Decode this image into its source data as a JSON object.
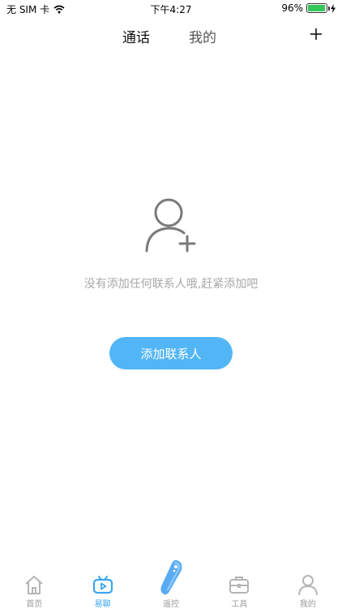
{
  "status_bar": {
    "carrier": "无 SIM 卡",
    "time": "下午4:27",
    "battery_percent": "96%",
    "battery_level": 0.96
  },
  "header": {
    "tabs": [
      {
        "label": "通话",
        "active": true
      },
      {
        "label": "我的",
        "active": false
      }
    ],
    "add_icon": "plus-icon"
  },
  "empty_state": {
    "icon": "add-person-icon",
    "message": "没有添加任何联系人哦,赶紧添加吧",
    "button_label": "添加联系人"
  },
  "tabbar": {
    "items": [
      {
        "label": "首页",
        "icon": "home-icon",
        "active": false
      },
      {
        "label": "易聊",
        "icon": "tv-chat-icon",
        "active": true
      },
      {
        "label": "遥控",
        "icon": "remote-icon",
        "active": false
      },
      {
        "label": "工具",
        "icon": "toolbox-icon",
        "active": false
      },
      {
        "label": "我的",
        "icon": "person-icon",
        "active": false
      }
    ]
  },
  "colors": {
    "accent": "#52b6f6",
    "active_tab": "#3aa6f0",
    "muted_text": "#a8a8a8",
    "inactive_icon": "#b5b5b5"
  }
}
